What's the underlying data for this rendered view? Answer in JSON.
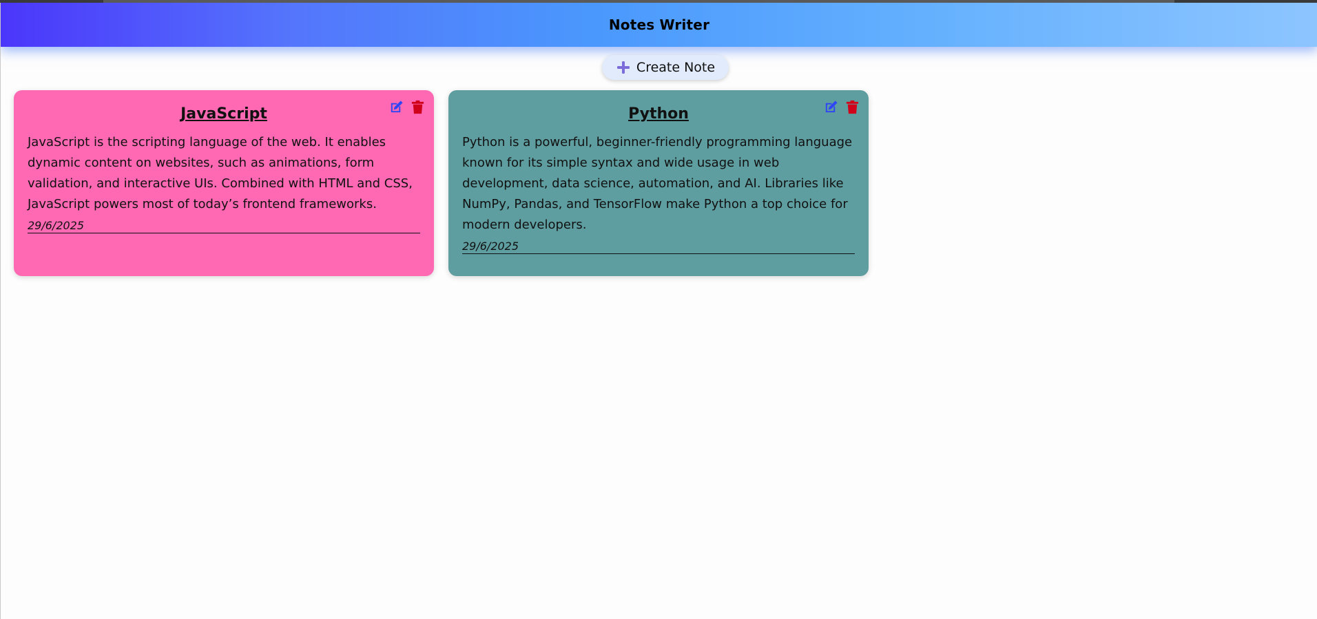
{
  "app": {
    "title": "Notes Writer"
  },
  "toolbar": {
    "create_label": "Create Note",
    "create_icon": "plus-icon",
    "create_icon_color": "#7b6cd9"
  },
  "colors": {
    "header_gradient": [
      "#4b36fb",
      "#4a98fd",
      "#8dc5ff"
    ],
    "edit_icon": "#2f45f5",
    "delete_icon": "#d0021b"
  },
  "notes": [
    {
      "title": "JavaScript",
      "body": "JavaScript is the scripting language of the web. It enables dynamic content on websites, such as animations, form validation, and interactive UIs. Combined with HTML and CSS, JavaScript powers most of today’s frontend frameworks.",
      "date": "29/6/2025",
      "color": "#ff69b4",
      "edit_icon": "edit-icon",
      "delete_icon": "trash-icon"
    },
    {
      "title": "Python",
      "body": "Python is a powerful, beginner-friendly programming language known for its simple syntax and wide usage in web development, data science, automation, and AI. Libraries like NumPy, Pandas, and TensorFlow make Python a top choice for modern developers.",
      "date": "29/6/2025",
      "color": "#5f9ea0",
      "edit_icon": "edit-icon",
      "delete_icon": "trash-icon"
    }
  ]
}
